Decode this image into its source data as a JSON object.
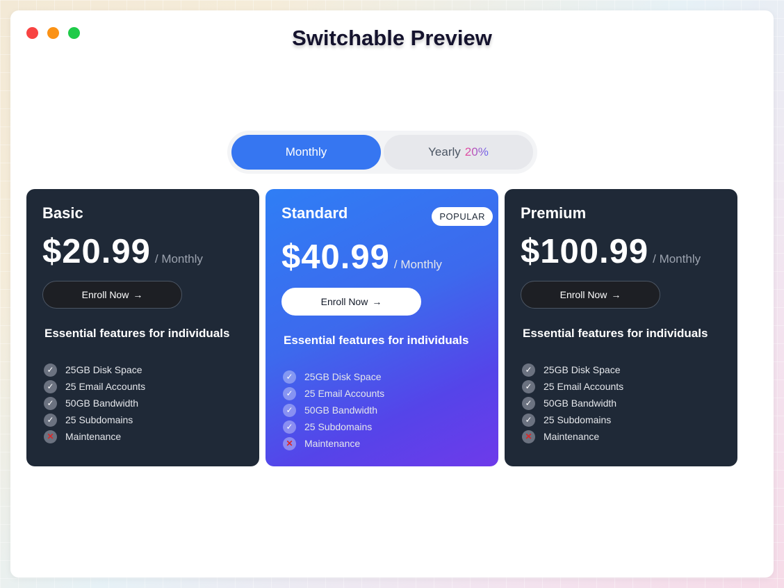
{
  "window": {
    "title": "Switchable Preview"
  },
  "billing_toggle": {
    "monthly_label": "Monthly",
    "yearly_label": "Yearly",
    "yearly_discount": "20%",
    "selected": "Monthly"
  },
  "plans": [
    {
      "name": "Basic",
      "price": "$20.99",
      "period": "/ Monthly",
      "cta": "Enroll Now",
      "features_title": "Essential features for individuals",
      "features": [
        {
          "label": "25GB Disk Space",
          "included": true
        },
        {
          "label": "25 Email Accounts",
          "included": true
        },
        {
          "label": "50GB Bandwidth",
          "included": true
        },
        {
          "label": "25 Subdomains",
          "included": true
        },
        {
          "label": "Maintenance",
          "included": false
        }
      ]
    },
    {
      "name": "Standard",
      "badge": "POPULAR",
      "price": "$40.99",
      "period": "/ Monthly",
      "cta": "Enroll Now",
      "features_title": "Essential features for individuals",
      "features": [
        {
          "label": "25GB Disk Space",
          "included": true
        },
        {
          "label": "25 Email Accounts",
          "included": true
        },
        {
          "label": "50GB Bandwidth",
          "included": true
        },
        {
          "label": "25 Subdomains",
          "included": true
        },
        {
          "label": "Maintenance",
          "included": false
        }
      ]
    },
    {
      "name": "Premium",
      "price": "$100.99",
      "period": "/ Monthly",
      "cta": "Enroll Now",
      "features_title": "Essential features for individuals",
      "features": [
        {
          "label": "25GB Disk Space",
          "included": true
        },
        {
          "label": "25 Email Accounts",
          "included": true
        },
        {
          "label": "50GB Bandwidth",
          "included": true
        },
        {
          "label": "25 Subdomains",
          "included": true
        },
        {
          "label": "Maintenance",
          "included": false
        }
      ]
    }
  ],
  "icons": {
    "check": "check-icon",
    "cross": "cross-icon",
    "arrow": "arrow-right-icon"
  },
  "colors": {
    "accent": "#3676f1",
    "card_dark": "#1f2937",
    "featured_gradient_start": "#2f7ef5",
    "featured_gradient_end": "#6e3aea"
  }
}
